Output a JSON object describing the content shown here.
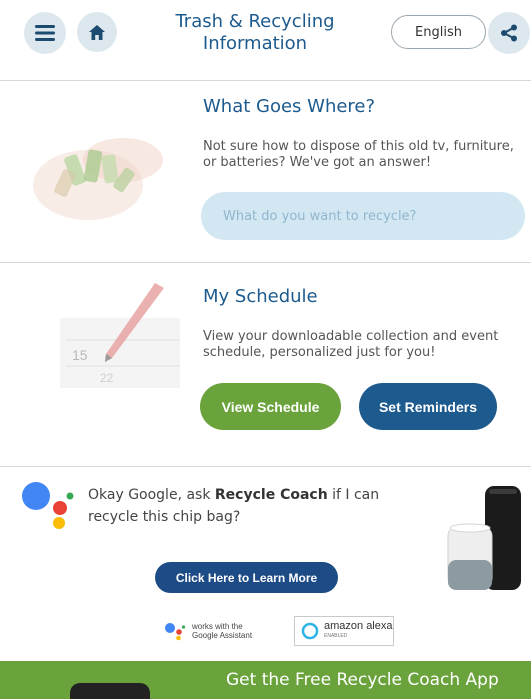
{
  "header": {
    "title": "Trash & Recycling Information",
    "language": "English",
    "icons": {
      "menu": "hamburger-menu-icon",
      "home": "home-icon",
      "share": "share-icon"
    }
  },
  "what_goes_where": {
    "title": "What Goes Where?",
    "description": "Not sure how to dispose of this old tv, furniture, or batteries? We've got an answer!",
    "search_placeholder": "What do you want to recycle?"
  },
  "schedule": {
    "title": "My Schedule",
    "description": "View your downloadable collection and event schedule, personalized just for you!",
    "view_button": "View Schedule",
    "reminders_button": "Set Reminders"
  },
  "assistant": {
    "prompt_start": "Okay Google, ask ",
    "prompt_brand": "Recycle Coach",
    "prompt_end": " if I can recycle this chip bag?",
    "learn_more_button": "Click Here to Learn More",
    "google_badge_line1": "works with the",
    "google_badge_line2": "Google Assistant",
    "alexa_badge": "amazon alexa",
    "alexa_badge_sub": "ENABLED"
  },
  "footer": {
    "banner_text": "Get the Free Recycle Coach App"
  },
  "colors": {
    "primary_blue": "#1d5a8d",
    "green": "#6aa33b",
    "search_bg": "#d3e7f3",
    "icon_bg": "#dde7ee"
  }
}
